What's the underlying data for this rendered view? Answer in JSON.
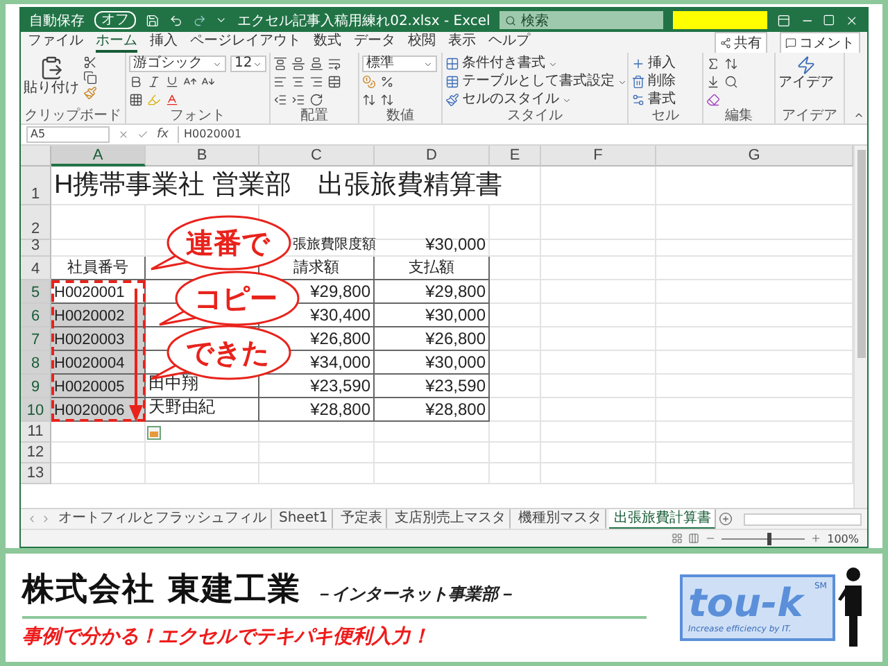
{
  "title_bar": {
    "autosave_label": "自動保存",
    "autosave_state": "オフ",
    "filename": "エクセル記事入稿用練れ02.xlsx - Excel",
    "search_placeholder": "検索"
  },
  "ribbon_tabs": [
    {
      "label": "ファイル",
      "selected": false
    },
    {
      "label": "ホーム",
      "selected": true
    },
    {
      "label": "挿入",
      "selected": false
    },
    {
      "label": "ページレイアウト",
      "selected": false
    },
    {
      "label": "数式",
      "selected": false
    },
    {
      "label": "データ",
      "selected": false
    },
    {
      "label": "校閲",
      "selected": false
    },
    {
      "label": "表示",
      "selected": false
    },
    {
      "label": "ヘルプ",
      "selected": false
    }
  ],
  "ribbon_actions": [
    "共有",
    "コメント"
  ],
  "ribbon": {
    "clipboard": {
      "paste": "貼り付け",
      "label": "クリップボード"
    },
    "font": {
      "name": "游ゴシック",
      "size": "12",
      "label": "フォント"
    },
    "alignment": {
      "label": "配置"
    },
    "number": {
      "format": "標準",
      "label": "数値"
    },
    "styles": {
      "buttons": [
        "条件付き書式",
        "テーブルとして書式設定",
        "セルのスタイル"
      ],
      "label": "スタイル"
    },
    "cells": {
      "buttons": [
        "挿入",
        "削除",
        "書式"
      ],
      "label": "セル"
    },
    "editing": {
      "label": "編集"
    },
    "ideas": {
      "button": "アイデア",
      "label": "アイデア"
    }
  },
  "formula_bar": {
    "name_box": "A5",
    "fx": "fx",
    "formula": "H0020001"
  },
  "sheet": {
    "columns": [
      {
        "label": "A",
        "selected": true
      },
      {
        "label": "B",
        "selected": false
      },
      {
        "label": "C",
        "selected": false
      },
      {
        "label": "D",
        "selected": false
      },
      {
        "label": "E",
        "selected": false
      },
      {
        "label": "F",
        "selected": false
      },
      {
        "label": "G",
        "selected": false
      }
    ],
    "rows": [
      {
        "number": "1",
        "kind": "title",
        "selected": false,
        "shaded": false,
        "cells": [
          "H携帯事業社 営業部　出張旅費精算書"
        ]
      },
      {
        "number": "2",
        "kind": "empty",
        "selected": false,
        "shaded": false
      },
      {
        "number": "3",
        "kind": "limit",
        "selected": false,
        "shaded": false,
        "cells": [
          null,
          null,
          "張旅費限度額",
          "¥30,000"
        ]
      },
      {
        "number": "4",
        "kind": "header",
        "selected": false,
        "shaded": false,
        "cells": [
          "社員番号",
          null,
          "請求額",
          "支払額"
        ]
      },
      {
        "number": "5",
        "kind": "data",
        "selected": true,
        "shaded": false,
        "cells": [
          "H0020001",
          null,
          "¥29,800",
          "¥29,800"
        ]
      },
      {
        "number": "6",
        "kind": "data",
        "selected": true,
        "shaded": true,
        "cells": [
          "H0020002",
          null,
          "¥30,400",
          "¥30,000"
        ]
      },
      {
        "number": "7",
        "kind": "data",
        "selected": true,
        "shaded": true,
        "cells": [
          "H0020003",
          null,
          "¥26,800",
          "¥26,800"
        ]
      },
      {
        "number": "8",
        "kind": "data",
        "selected": true,
        "shaded": true,
        "cells": [
          "H0020004",
          null,
          "¥34,000",
          "¥30,000"
        ]
      },
      {
        "number": "9",
        "kind": "data",
        "selected": true,
        "shaded": true,
        "cells": [
          "H0020005",
          "田中翔",
          "¥23,590",
          "¥23,590"
        ]
      },
      {
        "number": "10",
        "kind": "data",
        "selected": true,
        "shaded": true,
        "cells": [
          "H0020006",
          "天野由紀",
          "¥28,800",
          "¥28,800"
        ]
      },
      {
        "number": "11",
        "kind": "empty",
        "selected": false,
        "shaded": false
      },
      {
        "number": "12",
        "kind": "empty",
        "selected": false,
        "shaded": false
      },
      {
        "number": "13",
        "kind": "empty",
        "selected": false,
        "shaded": false
      }
    ]
  },
  "callouts": [
    "連番で",
    "コピー",
    "できた"
  ],
  "sheet_tabs": [
    {
      "label": "オートフィルとフラッシュフィル",
      "selected": false
    },
    {
      "label": "Sheet1",
      "selected": false
    },
    {
      "label": "予定表",
      "selected": false
    },
    {
      "label": "支店別売上マスタ",
      "selected": false
    },
    {
      "label": "機種別マスタ",
      "selected": false
    },
    {
      "label": "出張旅費計算書",
      "selected": true
    }
  ],
  "status_bar": {
    "zoom_slider": {
      "level": 0.55
    },
    "zoom": "100%"
  },
  "banner": {
    "company": "株式会社 東建工業",
    "division": "－インターネット事業部－",
    "tagline": "事例で分かる！エクセルでテキパキ便利入力！",
    "logo": {
      "wordmark": "tou-k",
      "mark": "SM",
      "slogan": "Increase efficiency by IT."
    }
  }
}
